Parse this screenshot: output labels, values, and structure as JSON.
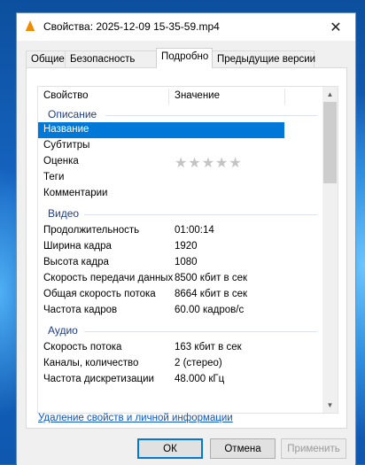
{
  "window": {
    "title": "Свойства: 2025-12-09 15-35-59.mp4",
    "close": "✕"
  },
  "tabs": [
    {
      "label": "Общие"
    },
    {
      "label": "Безопасность"
    },
    {
      "label": "Подробно"
    },
    {
      "label": "Предыдущие версии"
    }
  ],
  "active_tab": "Подробно",
  "columns": {
    "property": "Свойство",
    "value": "Значение"
  },
  "groups": {
    "description": "Описание",
    "video": "Видео",
    "audio": "Аудио"
  },
  "rows": {
    "title": {
      "p": "Название",
      "v": ""
    },
    "subtitles": {
      "p": "Субтитры",
      "v": ""
    },
    "rating": {
      "p": "Оценка",
      "stars": "★★★★★",
      "value": 0
    },
    "tags": {
      "p": "Теги",
      "v": ""
    },
    "comments": {
      "p": "Комментарии",
      "v": ""
    },
    "duration": {
      "p": "Продолжительность",
      "v": "01:00:14"
    },
    "width": {
      "p": "Ширина кадра",
      "v": "1920"
    },
    "height": {
      "p": "Высота кадра",
      "v": "1080"
    },
    "data_rate": {
      "p": "Скорость передачи данных",
      "v": "8500 кбит в сек"
    },
    "total_rate": {
      "p": "Общая скорость потока",
      "v": "8664 кбит в сек"
    },
    "framerate": {
      "p": "Частота кадров",
      "v": "60.00 кадров/с"
    },
    "bitrate": {
      "p": "Скорость потока",
      "v": "163 кбит в сек"
    },
    "channels": {
      "p": "Каналы, количество",
      "v": "2 (стерео)"
    },
    "sample_rate": {
      "p": "Частота дискретизации",
      "v": "48.000 кГц"
    }
  },
  "link": "Удаление свойств и личной информации",
  "buttons": {
    "ok": "ОК",
    "cancel": "Отмена",
    "apply": "Применить"
  },
  "colors": {
    "accent": "#0078d7",
    "group": "#1e3e8a",
    "link": "#0a57c5"
  },
  "icons": {
    "app": "vlc-cone-icon",
    "close": "close-icon",
    "scroll_up": "chevron-up-icon",
    "scroll_down": "chevron-down-icon"
  }
}
